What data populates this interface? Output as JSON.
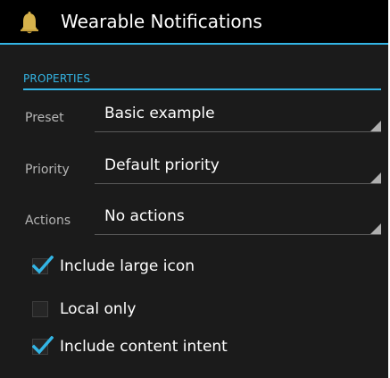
{
  "action_bar": {
    "title": "Wearable Notifications",
    "icon": "bell-icon"
  },
  "section": {
    "header": "PROPERTIES"
  },
  "properties": [
    {
      "label": "Preset",
      "value": "Basic example"
    },
    {
      "label": "Priority",
      "value": "Default priority"
    },
    {
      "label": "Actions",
      "value": "No actions"
    }
  ],
  "checkboxes": [
    {
      "label": "Include large icon",
      "checked": true
    },
    {
      "label": "Local only",
      "checked": false
    },
    {
      "label": "Include content intent",
      "checked": true
    }
  ],
  "colors": {
    "accent": "#33b5e5",
    "background": "#1b1b1b",
    "action_bar": "#000000",
    "bell": "#d6b24c"
  }
}
